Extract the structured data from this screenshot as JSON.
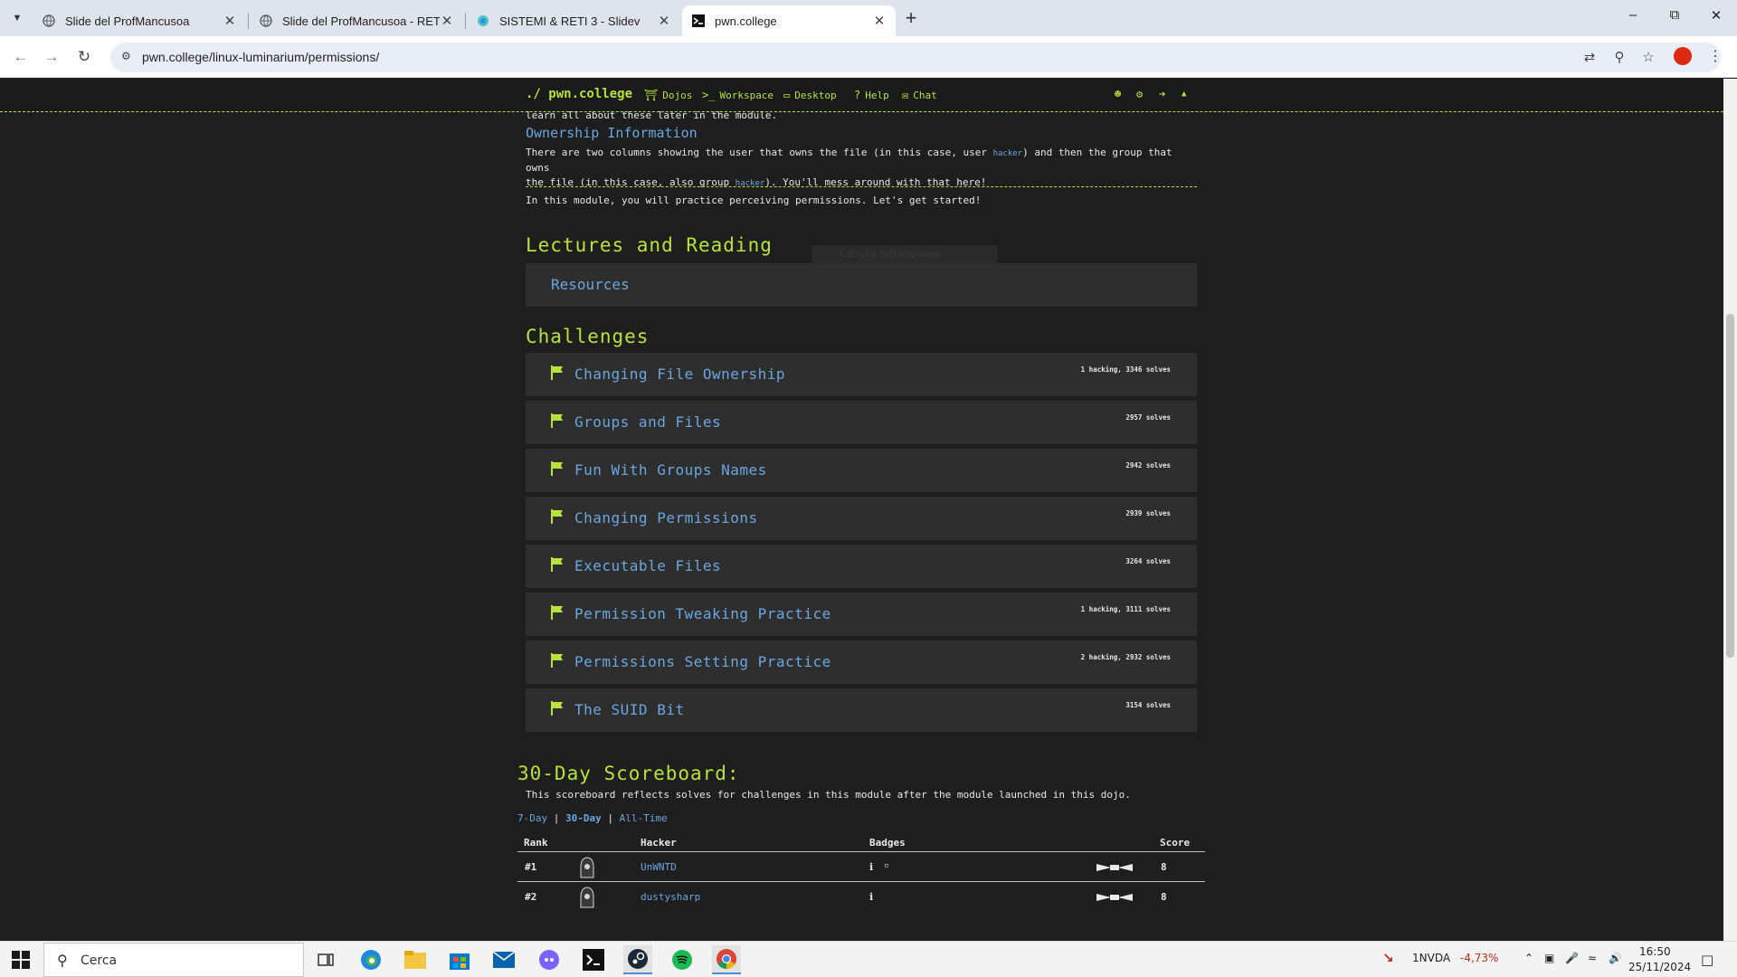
{
  "browser": {
    "tabs": [
      {
        "title": "Slide del ProfMancusoa",
        "active": false
      },
      {
        "title": "Slide del ProfMancusoa - RETI 3",
        "active": false
      },
      {
        "title": "SISTEMI & RETI 3 - Slidev",
        "active": false
      },
      {
        "title": "pwn.college",
        "active": true
      }
    ],
    "url": "pwn.college/linux-luminarium/permissions/"
  },
  "site": {
    "brand": "./ pwn.college",
    "nav": {
      "dojos": "Dojos",
      "workspace": "Workspace",
      "desktop": "Desktop",
      "help": "Help",
      "chat": "Chat"
    }
  },
  "intro": {
    "cut_line": "learn all about these later in the module.",
    "ownership_heading": "Ownership Information",
    "ownership_p1": "There are two columns showing the user that owns the file (in this case, user",
    "ownership_code1": "hacker",
    "ownership_p2": ") and then the group that owns",
    "ownership_p3": "the file (in this case, also group",
    "ownership_code2": "hacker",
    "ownership_p4": "). You'll mess around with that here!",
    "practice": "In this module, you will practice perceiving permissions. Let's get started!"
  },
  "lectures": {
    "heading": "Lectures and Reading",
    "overlay": "Cattura rettangolare",
    "resources": "Resources"
  },
  "challenges": {
    "heading": "Challenges",
    "items": [
      {
        "name": "Changing File Ownership",
        "solves": "1 hacking, 3346 solves"
      },
      {
        "name": "Groups and Files",
        "solves": "2957 solves"
      },
      {
        "name": "Fun With Groups Names",
        "solves": "2942 solves"
      },
      {
        "name": "Changing Permissions",
        "solves": "2939 solves"
      },
      {
        "name": "Executable Files",
        "solves": "3264 solves"
      },
      {
        "name": "Permission Tweaking Practice",
        "solves": "1 hacking, 3111 solves"
      },
      {
        "name": "Permissions Setting Practice",
        "solves": "2 hacking, 2932 solves"
      },
      {
        "name": "The SUID Bit",
        "solves": "3154 solves"
      }
    ]
  },
  "scoreboard": {
    "heading": "30-Day Scoreboard:",
    "description": "This scoreboard reflects solves for challenges in this module after the module launched in this dojo.",
    "tabs": [
      "7-Day",
      "30-Day",
      "All-Time"
    ],
    "separator": "|",
    "active_tab": "30-Day",
    "columns": {
      "rank": "Rank",
      "hacker": "Hacker",
      "badges": "Badges",
      "score": "Score"
    },
    "rows": [
      {
        "rank": "#1",
        "hacker": "UnWNTD",
        "score": "8"
      },
      {
        "rank": "#2",
        "hacker": "dustysharp",
        "score": "8"
      }
    ]
  },
  "taskbar": {
    "search_placeholder": "Cerca",
    "stock_name": "1NVDA",
    "stock_change": "-4,73%",
    "time": "16:50",
    "date": "25/11/2024"
  },
  "colors": {
    "accent_green": "#b8e33b",
    "link_blue": "#6aa7e0",
    "background": "#1e1e1e",
    "card": "#2e2e2e",
    "stock_red": "#c42b1c"
  }
}
